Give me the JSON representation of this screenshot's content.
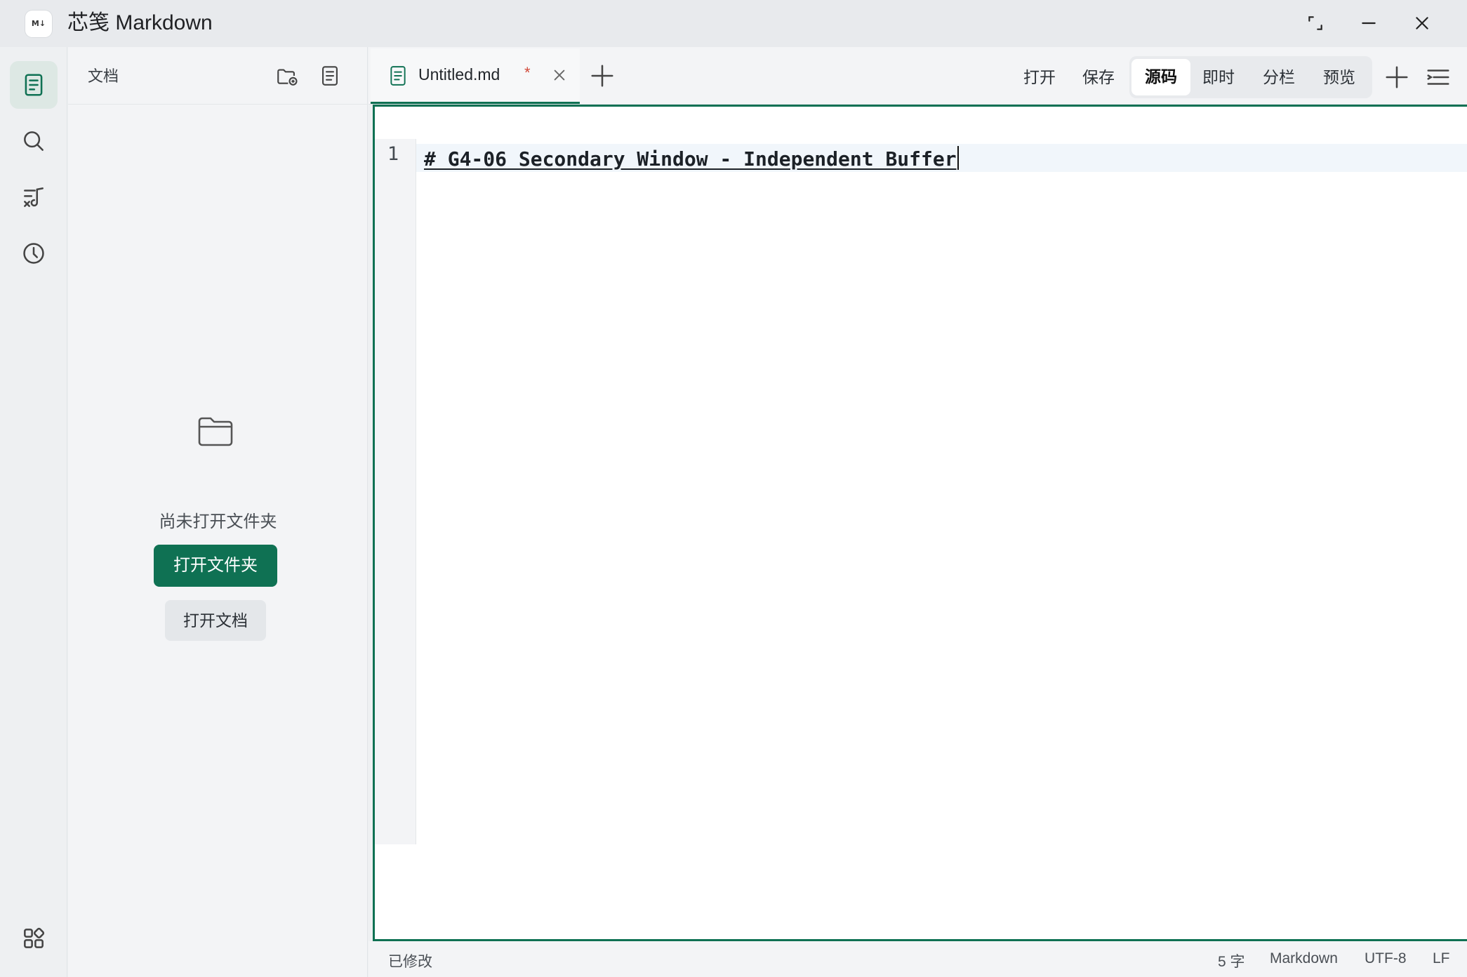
{
  "window": {
    "title": "芯笺 Markdown",
    "logo_text": "M↓"
  },
  "activity_bar": {
    "items": [
      {
        "icon": "document-icon",
        "active": true
      },
      {
        "icon": "search-icon",
        "active": false
      },
      {
        "icon": "outline-icon",
        "active": false
      },
      {
        "icon": "history-icon",
        "active": false
      }
    ],
    "bottom_icon": "apps-icon"
  },
  "sidebar": {
    "title": "文档",
    "actions": [
      "open-folder-icon",
      "new-document-icon"
    ],
    "empty_text": "尚未打开文件夹",
    "open_folder_label": "打开文件夹",
    "open_document_label": "打开文档"
  },
  "tabs": [
    {
      "label": "Untitled.md",
      "dirty_mark": "*",
      "active": true
    }
  ],
  "toolbar": {
    "open_label": "打开",
    "save_label": "保存",
    "modes": [
      "源码",
      "即时",
      "分栏",
      "预览"
    ],
    "active_mode": "源码"
  },
  "editor": {
    "lines": [
      {
        "number": "1",
        "text": "# G4-06 Secondary Window - Independent Buffer"
      }
    ]
  },
  "status_bar": {
    "state": "已修改",
    "word_count": "5 字",
    "language": "Markdown",
    "encoding": "UTF-8",
    "line_ending": "LF"
  },
  "colors": {
    "accent": "#0f7153",
    "dirty": "#d24a3a"
  }
}
